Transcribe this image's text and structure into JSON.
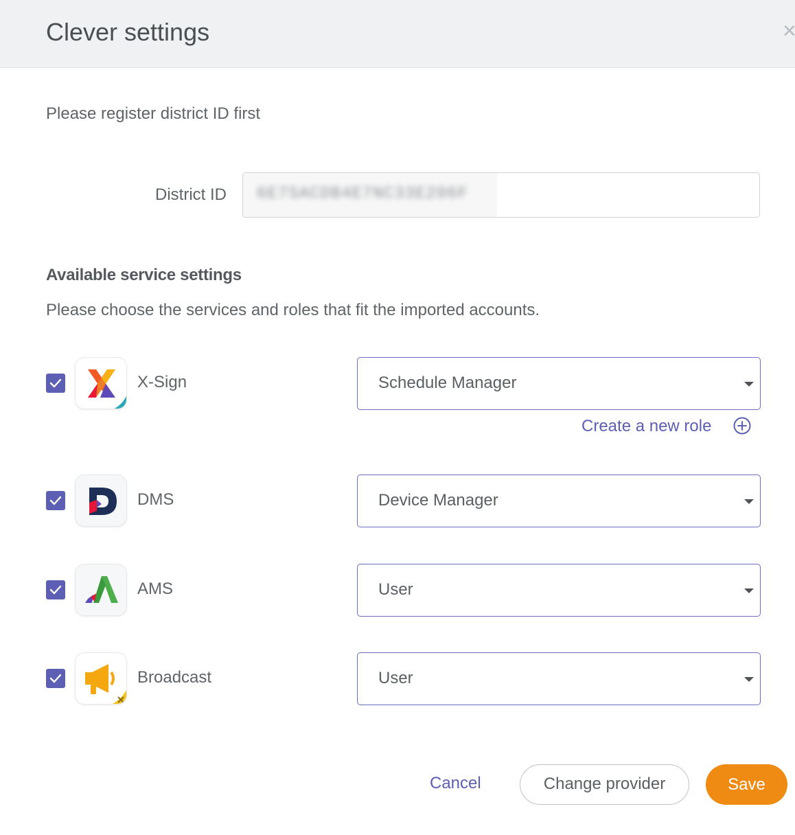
{
  "header": {
    "title": "Clever settings",
    "close_glyph": "×"
  },
  "intro": "Please register district ID first",
  "district": {
    "label": "District ID",
    "value": "6E7SACDB4E7NC33E206F"
  },
  "services_section": {
    "title": "Available service settings",
    "subtitle": "Please choose the services and roles that fit the imported accounts."
  },
  "services": [
    {
      "name": "X-Sign",
      "icon": "x-sign-app-icon",
      "checked": true,
      "role": "Schedule Manager"
    },
    {
      "name": "DMS",
      "icon": "dms-app-icon",
      "checked": true,
      "role": "Device Manager"
    },
    {
      "name": "AMS",
      "icon": "ams-app-icon",
      "checked": true,
      "role": "User"
    },
    {
      "name": "Broadcast",
      "icon": "broadcast-app-icon",
      "checked": true,
      "role": "User"
    }
  ],
  "create_role": {
    "label": "Create a new role",
    "icon": "plus-circle-icon"
  },
  "footer": {
    "cancel": "Cancel",
    "change_provider": "Change provider",
    "save": "Save"
  },
  "colors": {
    "accent": "#5c5fb3",
    "save": "#ef8a12",
    "header_bg": "#eff1f3"
  }
}
